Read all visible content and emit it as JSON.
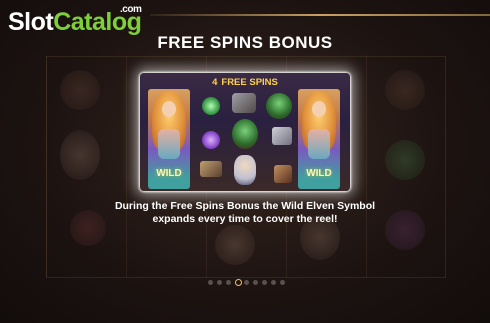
{
  "logo": {
    "slot": "Slot",
    "catalog": "Catalog",
    "com": ".com"
  },
  "title": "FREE SPINS BONUS",
  "preview": {
    "free_spins_count": "4",
    "free_spins_label": "FREE SPINS",
    "wild_left": "WILD",
    "wild_right": "WILD"
  },
  "description": {
    "line1": "During the Free Spins Bonus the Wild Elven Symbol",
    "line2": "expands every time to cover the reel!"
  },
  "pagination": {
    "total": 9,
    "active_index": 3
  },
  "colors": {
    "logo_catalog": "#7fcf3a",
    "banner_gold": "#ffd24a",
    "active_dot_ring": "#f0c070",
    "inactive_dot": "#5a5050"
  }
}
